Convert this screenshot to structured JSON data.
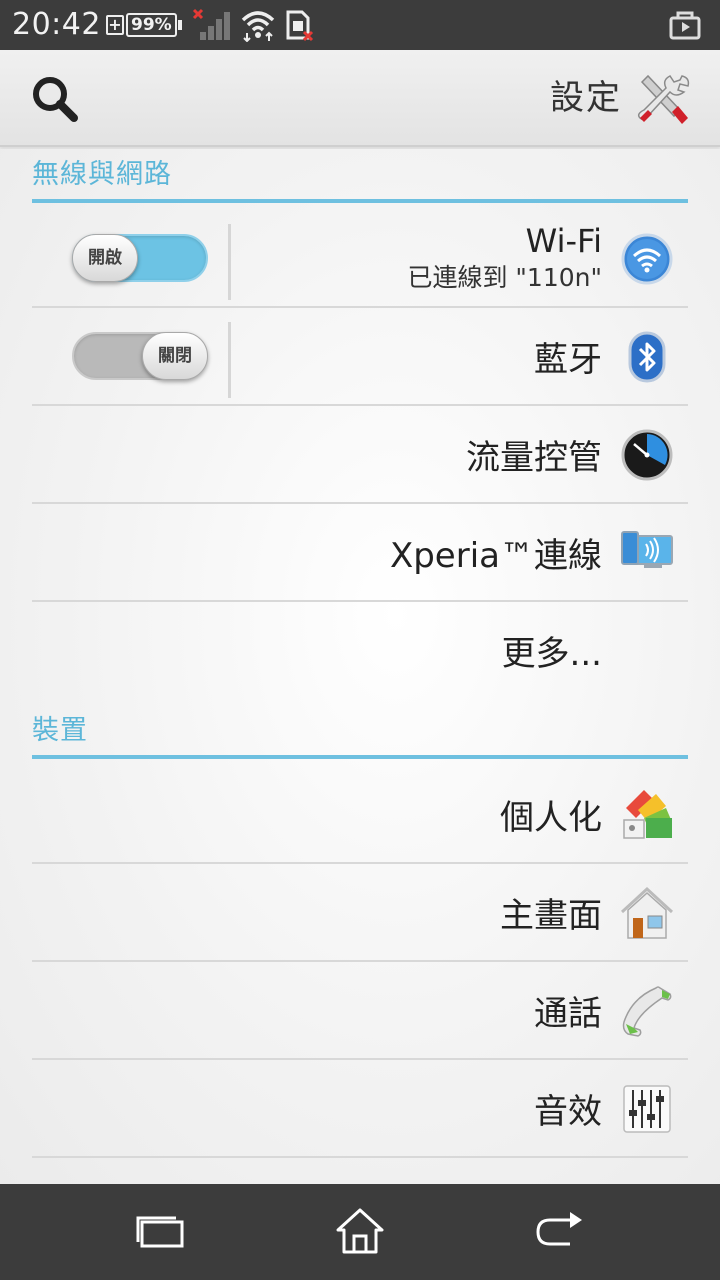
{
  "status_bar": {
    "time": "20:42",
    "battery_percent": "99%",
    "icons": [
      "battery-charging-icon",
      "signal-no-service-icon",
      "wifi-icon",
      "sim-missing-icon",
      "screenshot-share-icon"
    ]
  },
  "action_bar": {
    "search_icon": "search-icon",
    "title": "設定",
    "title_icon": "tools-icon"
  },
  "sections": {
    "wireless": {
      "header": "無線與網路",
      "wifi": {
        "toggle_label": "開啟",
        "toggle_state": "on",
        "title": "Wi-Fi",
        "summary": "已連線到 \"110n\"",
        "icon": "wifi-settings-icon"
      },
      "bluetooth": {
        "toggle_label": "關閉",
        "toggle_state": "off",
        "title": "藍牙",
        "icon": "bluetooth-icon"
      },
      "data_usage": {
        "title": "流量控管",
        "icon": "data-usage-icon"
      },
      "xperia_connect": {
        "title": "Xperia™連線",
        "icon": "xperia-connect-icon"
      },
      "more": {
        "title": "更多..."
      }
    },
    "device": {
      "header": "裝置",
      "personalization": {
        "title": "個人化",
        "icon": "personalization-icon"
      },
      "home_screen": {
        "title": "主畫面",
        "icon": "home-screen-icon"
      },
      "call": {
        "title": "通話",
        "icon": "phone-icon"
      },
      "sound": {
        "title": "音效",
        "icon": "equalizer-icon"
      }
    }
  },
  "nav_bar": {
    "icons": [
      "recent-apps-icon",
      "home-icon",
      "back-icon"
    ]
  },
  "colors": {
    "accent": "#6ec0e0",
    "section_text": "#5cb6d8",
    "bars": "#3c3c3c",
    "toggle_on": "#6cc3e4",
    "toggle_off": "#b9b9b9"
  }
}
